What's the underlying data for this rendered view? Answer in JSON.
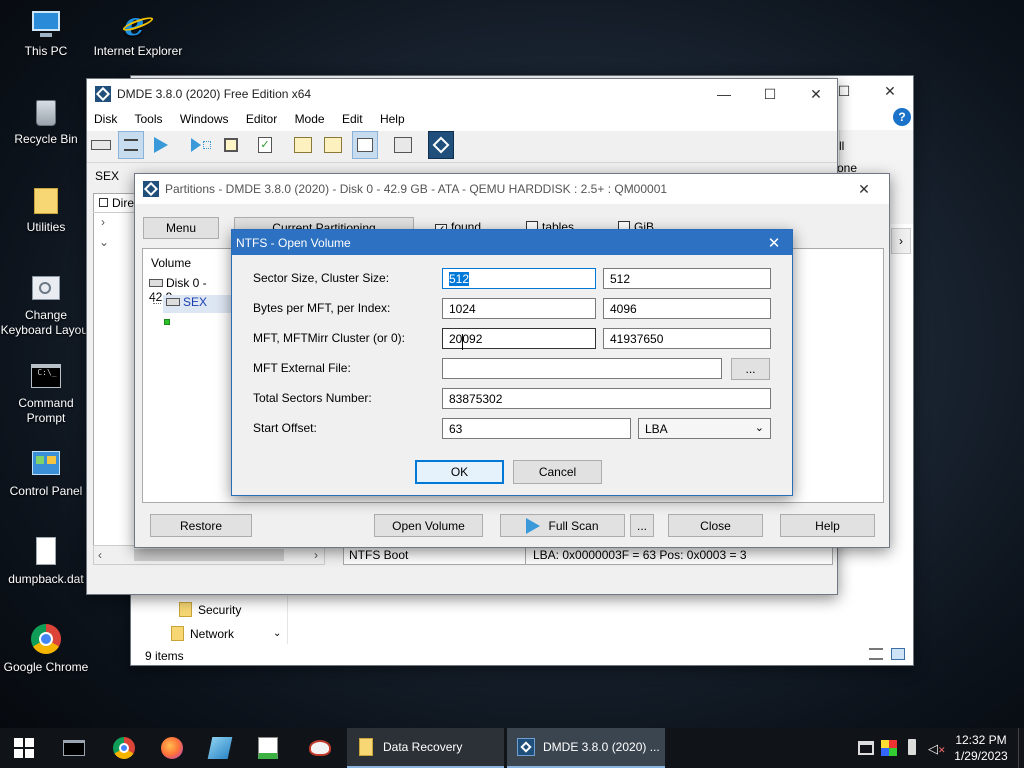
{
  "desktop": {
    "icons": [
      {
        "label": "This PC",
        "icon": "pc-icon"
      },
      {
        "label": "Internet Explorer",
        "icon": "ie-icon"
      },
      {
        "label": "Recycle Bin",
        "icon": "recycle-bin-icon"
      },
      {
        "label": "Utilities",
        "icon": "folder-icon"
      },
      {
        "label": "Change Keyboard Layout",
        "icon": "keyboard-icon"
      },
      {
        "label": "Command Prompt",
        "icon": "cmd-icon"
      },
      {
        "label": "Control Panel",
        "icon": "control-panel-icon"
      },
      {
        "label": "dumpback.dat",
        "icon": "file-icon"
      },
      {
        "label": "Google Chrome",
        "icon": "chrome-icon"
      }
    ]
  },
  "explorer": {
    "status": "9 items",
    "nav_items": [
      "Security",
      "Network"
    ],
    "partial_right": [
      "ll",
      "one"
    ]
  },
  "dmde": {
    "title": "DMDE 3.8.0 (2020) Free Edition x64",
    "menu": [
      "Disk",
      "Tools",
      "Windows",
      "Editor",
      "Mode",
      "Edit",
      "Help"
    ],
    "volume_label": "SEX",
    "tree_partial": "Dire",
    "bottom_left": "NTFS Boot",
    "bottom_right": "LBA: 0x0000003F = 63  Pos: 0x0003 = 3"
  },
  "partitions": {
    "title": "Partitions - DMDE 3.8.0 (2020) - Disk 0 - 42.9 GB - ATA - QEMU HARDDISK : 2.5+ : QM00001",
    "menu_btn": "Menu",
    "current_partitioning": "Current Partitioning",
    "check_found": "found",
    "check_tables": "tables",
    "check_gib": "GiB",
    "column_volume": "Volume",
    "disk_item": "Disk 0 - 42.9",
    "sex_item": "SEX",
    "buttons": {
      "restore": "Restore",
      "open_volume": "Open Volume",
      "full_scan": "Full Scan",
      "more": "...",
      "close": "Close",
      "help": "Help"
    }
  },
  "dialog": {
    "title": "NTFS - Open Volume",
    "rows": {
      "sector_size_label": "Sector Size, Cluster Size:",
      "sector_size": "512",
      "cluster_size": "512",
      "bytes_label": "Bytes per MFT, per Index:",
      "bytes_mft": "1024",
      "bytes_index": "4096",
      "mft_label": "MFT, MFTMirr Cluster (or 0):",
      "mft_cluster": "20092",
      "mftmirr_cluster": "41937650",
      "ext_label": "MFT External File:",
      "ext_value": "",
      "browse": "...",
      "total_label": "Total Sectors Number:",
      "total_value": "83875302",
      "start_label": "Start Offset:",
      "start_value": "63",
      "unit": "LBA"
    },
    "ok": "OK",
    "cancel": "Cancel"
  },
  "taskbar": {
    "apps": [
      {
        "label": "Data Recovery",
        "icon": "folder-icon"
      },
      {
        "label": "DMDE 3.8.0 (2020) ...",
        "icon": "dmde-icon"
      }
    ],
    "time": "12:32 PM",
    "date": "1/29/2023"
  }
}
